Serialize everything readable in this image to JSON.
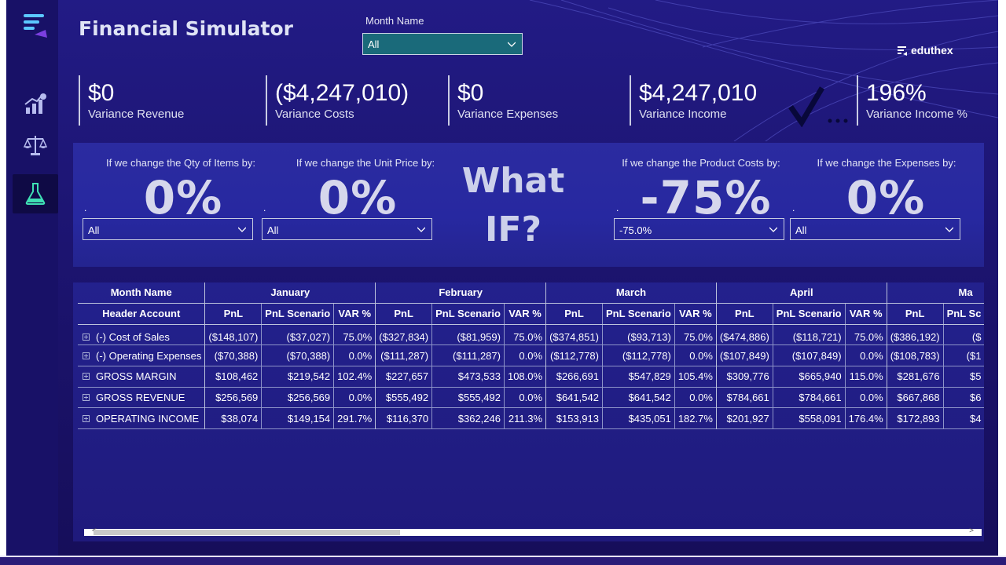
{
  "app": {
    "title": "Financial Simulator",
    "logo_text": "eduthex"
  },
  "sidebar": {
    "items": [
      {
        "icon": "menu-icon"
      },
      {
        "icon": "growth-chart-icon"
      },
      {
        "icon": "balance-scale-icon"
      },
      {
        "icon": "flask-icon",
        "active": true
      }
    ]
  },
  "filter": {
    "label": "Month Name",
    "value": "All"
  },
  "kpis": [
    {
      "value": "$0",
      "label": "Variance Revenue"
    },
    {
      "value": "($4,247,010)",
      "label": "Variance Costs"
    },
    {
      "value": "$0",
      "label": "Variance Expenses"
    },
    {
      "value": "$4,247,010",
      "label": "Variance Income"
    },
    {
      "value": "196%",
      "label": "Variance Income %"
    }
  ],
  "whatif": {
    "title": "What IF?",
    "title_line1": "What",
    "title_line2": "IF?",
    "qty": {
      "caption": "If we change the Qty of Items by:",
      "value": "0%",
      "dot": ".",
      "select": "All"
    },
    "price": {
      "caption": "If we change the Unit Price by:",
      "value": "0%",
      "dot": ".",
      "select": "All"
    },
    "costs": {
      "caption": "If we change the Product Costs by:",
      "value": "-75%",
      "dot": ".",
      "select": "-75.0%"
    },
    "expenses": {
      "caption": "If we change the Expenses by:",
      "value": "0%",
      "dot": ".",
      "select": "All"
    }
  },
  "matrix": {
    "row_header_group": "Month Name",
    "row_header": "Header Account",
    "months": [
      "January",
      "February",
      "March",
      "April",
      "Ma"
    ],
    "sub_columns": [
      "PnL",
      "PnL Scenario",
      "VAR %"
    ],
    "last_sub_columns": [
      "PnL",
      "PnL Sc"
    ],
    "rows": [
      {
        "account": "(-) Cost of Sales",
        "jan": [
          "($148,107)",
          "($37,027)",
          "75.0%"
        ],
        "feb": [
          "($327,834)",
          "($81,959)",
          "75.0%"
        ],
        "mar": [
          "($374,851)",
          "($93,713)",
          "75.0%"
        ],
        "apr": [
          "($474,886)",
          "($118,721)",
          "75.0%"
        ],
        "may": [
          "($386,192)",
          "($"
        ]
      },
      {
        "account": "(-) Operating Expenses",
        "jan": [
          "($70,388)",
          "($70,388)",
          "0.0%"
        ],
        "feb": [
          "($111,287)",
          "($111,287)",
          "0.0%"
        ],
        "mar": [
          "($112,778)",
          "($112,778)",
          "0.0%"
        ],
        "apr": [
          "($107,849)",
          "($107,849)",
          "0.0%"
        ],
        "may": [
          "($108,783)",
          "($1"
        ]
      },
      {
        "account": "GROSS MARGIN",
        "jan": [
          "$108,462",
          "$219,542",
          "102.4%"
        ],
        "feb": [
          "$227,657",
          "$473,533",
          "108.0%"
        ],
        "mar": [
          "$266,691",
          "$547,829",
          "105.4%"
        ],
        "apr": [
          "$309,776",
          "$665,940",
          "115.0%"
        ],
        "may": [
          "$281,676",
          "$5"
        ]
      },
      {
        "account": "GROSS REVENUE",
        "jan": [
          "$256,569",
          "$256,569",
          "0.0%"
        ],
        "feb": [
          "$555,492",
          "$555,492",
          "0.0%"
        ],
        "mar": [
          "$641,542",
          "$641,542",
          "0.0%"
        ],
        "apr": [
          "$784,661",
          "$784,661",
          "0.0%"
        ],
        "may": [
          "$667,868",
          "$6"
        ]
      },
      {
        "account": "OPERATING INCOME",
        "jan": [
          "$38,074",
          "$149,154",
          "291.7%"
        ],
        "feb": [
          "$116,370",
          "$362,246",
          "211.3%"
        ],
        "mar": [
          "$153,913",
          "$435,051",
          "182.7%"
        ],
        "apr": [
          "$201,927",
          "$558,091",
          "176.4%"
        ],
        "may": [
          "$172,893",
          "$4"
        ]
      }
    ],
    "scroll_left": "<",
    "scroll_right": ">"
  },
  "colors": {
    "background": "#1c1470",
    "panel": "#2728a0",
    "filter_fill": "#1a6a7a",
    "text": "#ffffff"
  }
}
